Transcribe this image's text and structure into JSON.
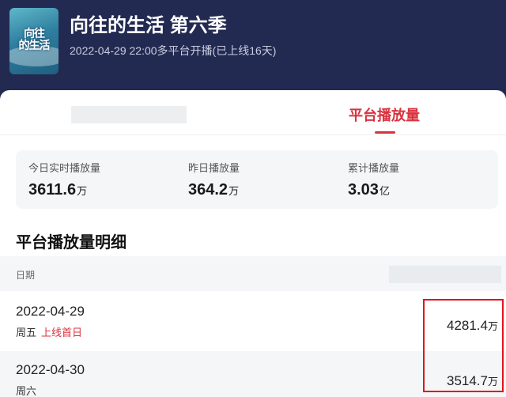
{
  "show": {
    "title": "向往的生活 第六季",
    "subtitle": "2022-04-29 22:00多平台开播(已上线16天)",
    "poster_logo": "向往的生活",
    "poster_icon": "show-poster"
  },
  "tabs": {
    "active_label": "平台播放量"
  },
  "stats": [
    {
      "label": "今日实时播放量",
      "value": "3611.6",
      "unit": "万"
    },
    {
      "label": "昨日播放量",
      "value": "364.2",
      "unit": "万"
    },
    {
      "label": "累计播放量",
      "value": "3.03",
      "unit": "亿"
    }
  ],
  "section": {
    "title": "平台播放量明细",
    "column_date": "日期"
  },
  "rows": [
    {
      "date": "2022-04-29",
      "day": "周五",
      "tag": "上线首日",
      "value": "4281.4",
      "unit": "万"
    },
    {
      "date": "2022-04-30",
      "day": "周六",
      "tag": "",
      "value": "3514.7",
      "unit": "万"
    }
  ],
  "colors": {
    "header_bg": "#232a52",
    "accent": "#d8323e",
    "highlight_border": "#e0141c"
  }
}
